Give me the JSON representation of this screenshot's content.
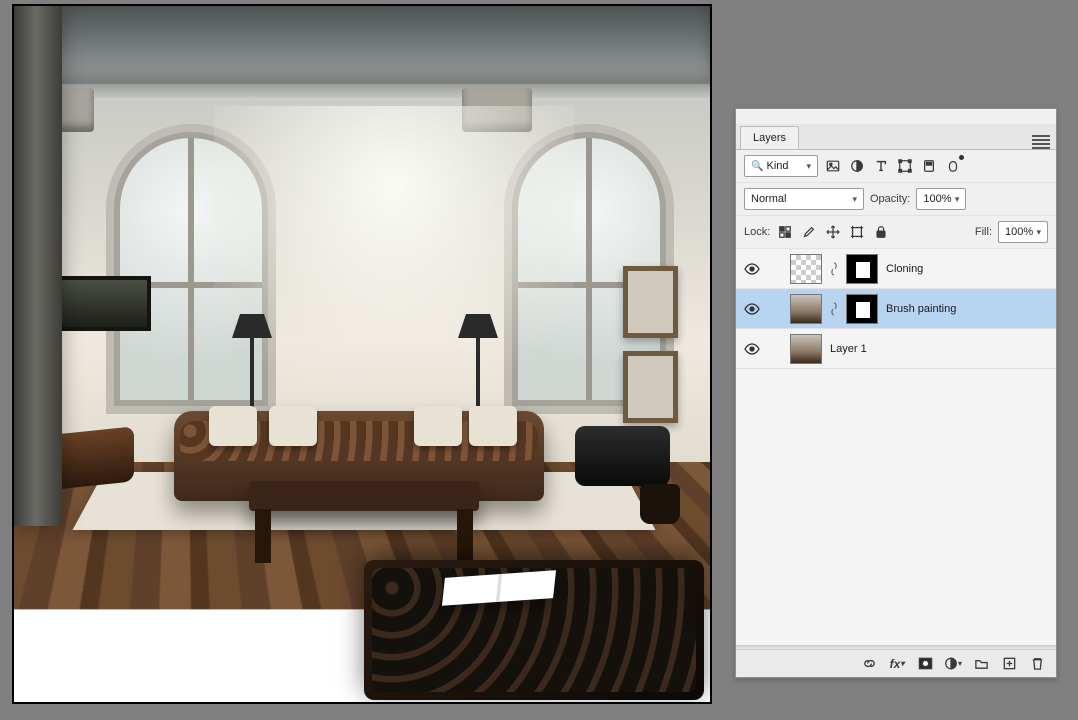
{
  "panel": {
    "tab_label": "Layers",
    "filter_label": "Kind",
    "blend_mode": "Normal",
    "opacity_label": "Opacity:",
    "opacity_value": "100%",
    "lock_label": "Lock:",
    "fill_label": "Fill:",
    "fill_value": "100%"
  },
  "layers": [
    {
      "name": "Cloning",
      "visible": true,
      "has_mask": true,
      "thumb": "checker",
      "selected": false
    },
    {
      "name": "Brush painting",
      "visible": true,
      "has_mask": true,
      "thumb": "img",
      "selected": true
    },
    {
      "name": "Layer 1",
      "visible": true,
      "has_mask": false,
      "thumb": "img",
      "selected": false
    }
  ],
  "icons": {
    "filter_image": "image-icon",
    "filter_adjust": "adjust-icon",
    "filter_type": "type-icon",
    "filter_shape": "shape-icon",
    "filter_smart": "smart-object-icon",
    "filter_art": "artboard-icon",
    "lock_pixels": "lock-pixels-icon",
    "lock_brush": "lock-brush-icon",
    "lock_move": "lock-position-icon",
    "lock_artb": "lock-artboard-icon",
    "lock_all": "lock-all-icon",
    "foot_link": "link-layers-icon",
    "foot_fx": "fx-icon",
    "foot_mask": "add-mask-icon",
    "foot_adj": "adjustment-layer-icon",
    "foot_group": "group-icon",
    "foot_new": "new-layer-icon",
    "foot_trash": "trash-icon"
  }
}
